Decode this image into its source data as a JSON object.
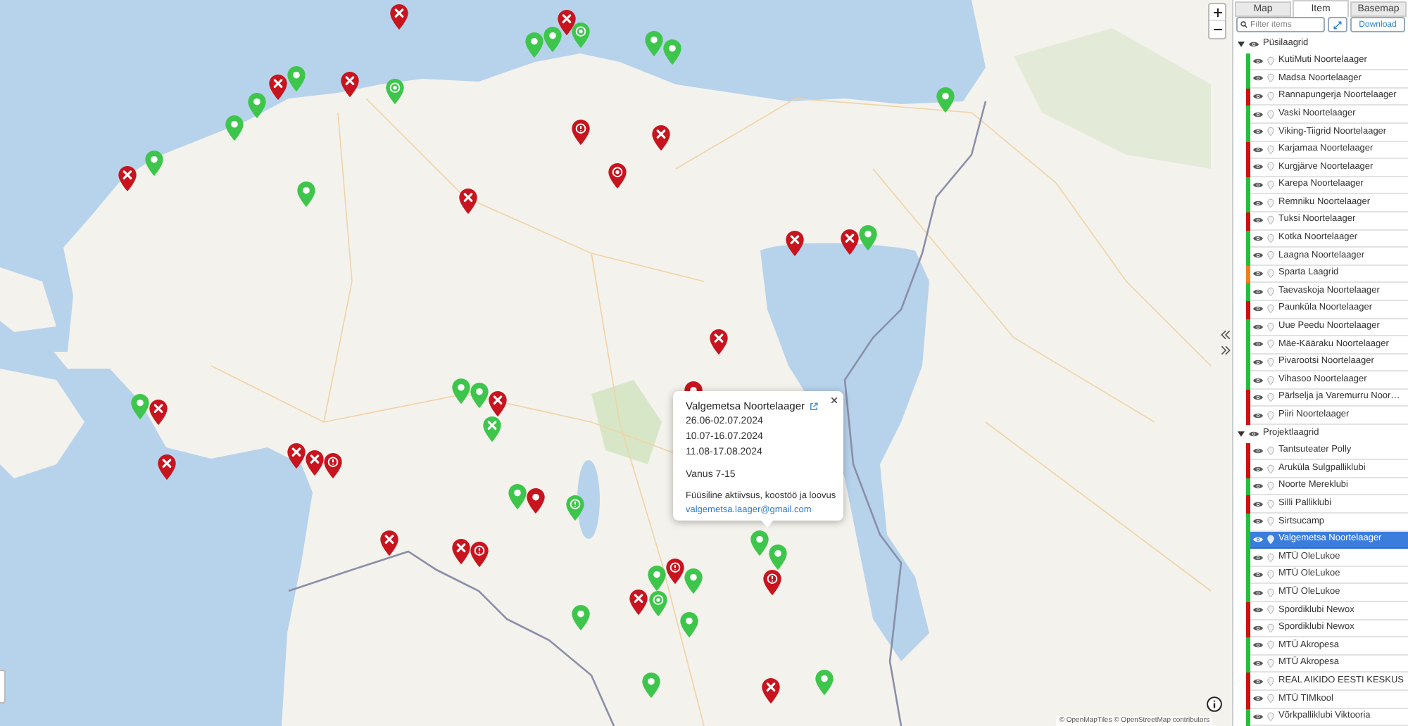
{
  "map": {
    "markers": [
      {
        "kind": "cross",
        "color": "#c8141e"
      },
      {
        "kind": "cross",
        "color": "#c8141e"
      },
      {
        "kind": "dot",
        "color": "#3ec64c"
      },
      {
        "kind": "dot",
        "color": "#3ec64c"
      },
      {
        "kind": "ring",
        "color": "#3ec64c"
      },
      {
        "kind": "dot",
        "color": "#3ec64c"
      },
      {
        "kind": "dot",
        "color": "#3ec64c"
      },
      {
        "kind": "cross",
        "color": "#c8141e"
      },
      {
        "kind": "dot",
        "color": "#3ec64c"
      },
      {
        "kind": "cross",
        "color": "#c8141e"
      },
      {
        "kind": "ring",
        "color": "#3ec64c"
      },
      {
        "kind": "dot",
        "color": "#3ec64c"
      },
      {
        "kind": "dot",
        "color": "#3ec64c"
      },
      {
        "kind": "dot",
        "color": "#3ec64c"
      },
      {
        "kind": "cross",
        "color": "#c8141e"
      },
      {
        "kind": "dot",
        "color": "#3ec64c"
      },
      {
        "kind": "cross",
        "color": "#c8141e"
      },
      {
        "kind": "info",
        "color": "#c8141e"
      },
      {
        "kind": "ring",
        "color": "#c8141e"
      },
      {
        "kind": "cross",
        "color": "#c8141e"
      },
      {
        "kind": "dot",
        "color": "#3ec64c"
      },
      {
        "kind": "cross",
        "color": "#c8141e"
      },
      {
        "kind": "dot",
        "color": "#3ec64c"
      },
      {
        "kind": "cross",
        "color": "#c8141e"
      },
      {
        "kind": "cross",
        "color": "#c8141e"
      },
      {
        "kind": "dot",
        "color": "#c8141e"
      },
      {
        "kind": "dot",
        "color": "#3ec64c"
      },
      {
        "kind": "cross",
        "color": "#c8141e"
      },
      {
        "kind": "cross",
        "color": "#c8141e"
      },
      {
        "kind": "cross",
        "color": "#c8141e"
      },
      {
        "kind": "cross",
        "color": "#c8141e"
      },
      {
        "kind": "info",
        "color": "#c8141e"
      },
      {
        "kind": "dot",
        "color": "#3ec64c"
      },
      {
        "kind": "dot",
        "color": "#3ec64c"
      },
      {
        "kind": "cross",
        "color": "#c8141e"
      },
      {
        "kind": "cross",
        "color": "#3ec64c"
      },
      {
        "kind": "dot",
        "color": "#c8141e"
      },
      {
        "kind": "dot",
        "color": "#3ec64c"
      },
      {
        "kind": "info",
        "color": "#3ec64c"
      },
      {
        "kind": "cross",
        "color": "#c8141e"
      },
      {
        "kind": "cross",
        "color": "#c8141e"
      },
      {
        "kind": "info",
        "color": "#c8141e"
      },
      {
        "kind": "dot",
        "color": "#3ec64c"
      },
      {
        "kind": "dot",
        "color": "#3ec64c"
      },
      {
        "kind": "dot",
        "color": "#3ec64c"
      },
      {
        "kind": "info",
        "color": "#c8141e"
      },
      {
        "kind": "info",
        "color": "#c8141e"
      },
      {
        "kind": "dot",
        "color": "#3ec64c"
      },
      {
        "kind": "dot",
        "color": "#3ec64c"
      },
      {
        "kind": "cross",
        "color": "#c8141e"
      },
      {
        "kind": "ring",
        "color": "#3ec64c"
      },
      {
        "kind": "dot",
        "color": "#3ec64c"
      },
      {
        "kind": "dot",
        "color": "#3ec64c"
      },
      {
        "kind": "cross",
        "color": "#c8141e"
      },
      {
        "kind": "dot",
        "color": "#3ec64c"
      }
    ],
    "attribution": "© OpenMapTiles © OpenStreetMap contributors"
  },
  "popup": {
    "title": "Valgemetsa Noortelaager",
    "dates": [
      "26.06-02.07.2024",
      "10.07-16.07.2024",
      "11.08-17.08.2024"
    ],
    "age": "Vanus 7-15",
    "description": "Füüsiline aktiivsus, koostöö ja loovus",
    "email": "valgemetsa.laager@gmail.com"
  },
  "panel": {
    "tabs": [
      {
        "label": "Map",
        "selected": false
      },
      {
        "label": "Item",
        "selected": true
      },
      {
        "label": "Basemap",
        "selected": false
      }
    ],
    "filter": {
      "placeholder": "Filter items"
    },
    "download_button": "Download",
    "groups": [
      {
        "label": "Püsilaagrid",
        "expanded": true,
        "children": [
          {
            "label": "KutiMuti Noortelaager",
            "color": "#22c03a",
            "selected": false
          },
          {
            "label": "Madsa Noortelaager",
            "color": "#22c03a",
            "selected": false
          },
          {
            "label": "Rannapungerja Noortelaager",
            "color": "#cc1111",
            "selected": false
          },
          {
            "label": "Vaski Noortelaager",
            "color": "#22c03a",
            "selected": false
          },
          {
            "label": "Viking-Tiigrid Noortelaager",
            "color": "#22c03a",
            "selected": false
          },
          {
            "label": "Karjamaa Noortelaager",
            "color": "#cc1111",
            "selected": false
          },
          {
            "label": "Kurgjärve Noortelaager",
            "color": "#cc1111",
            "selected": false
          },
          {
            "label": "Karepa Noortelaager",
            "color": "#22c03a",
            "selected": false
          },
          {
            "label": "Remniku Noortelaager",
            "color": "#22c03a",
            "selected": false
          },
          {
            "label": "Tuksi Noortelaager",
            "color": "#cc1111",
            "selected": false
          },
          {
            "label": "Kotka Noortelaager",
            "color": "#22c03a",
            "selected": false
          },
          {
            "label": "Laagna Noortelaager",
            "color": "#22c03a",
            "selected": false
          },
          {
            "label": "Sparta Laagrid",
            "color": "#f07f1a",
            "selected": false
          },
          {
            "label": "Taevaskoja Noortelaager",
            "color": "#22c03a",
            "selected": false
          },
          {
            "label": "Paunküla Noortelaager",
            "color": "#cc1111",
            "selected": false
          },
          {
            "label": "Uue Peedu Noortelaager",
            "color": "#22c03a",
            "selected": false
          },
          {
            "label": "Mäe-Kääraku Noortelaager",
            "color": "#22c03a",
            "selected": false
          },
          {
            "label": "Pivarootsi Noortelaager",
            "color": "#22c03a",
            "selected": false
          },
          {
            "label": "Vihasoo Noortelaager",
            "color": "#22c03a",
            "selected": false
          },
          {
            "label": "Pärlselja ja Varemurru Noor…",
            "color": "#cc1111",
            "selected": false
          },
          {
            "label": "Piiri Noortelaager",
            "color": "#cc1111",
            "selected": false
          }
        ]
      },
      {
        "label": "Projektlaagrid",
        "expanded": true,
        "children": [
          {
            "label": "Tantsuteater Polly",
            "color": "#cc1111",
            "selected": false
          },
          {
            "label": "Aruküla Sulgpalliklubi",
            "color": "#cc1111",
            "selected": false
          },
          {
            "label": "Noorte Mereklubi",
            "color": "#22c03a",
            "selected": false
          },
          {
            "label": "Silli Palliklubi",
            "color": "#cc1111",
            "selected": false
          },
          {
            "label": "Sirtsucamp",
            "color": "#22c03a",
            "selected": false
          },
          {
            "label": "Valgemetsa Noortelaager",
            "color": "#22c03a",
            "selected": true
          },
          {
            "label": "MTÜ OleLukoe",
            "color": "#22c03a",
            "selected": false
          },
          {
            "label": "MTÜ OleLukoe",
            "color": "#22c03a",
            "selected": false
          },
          {
            "label": "MTÜ OleLukoe",
            "color": "#22c03a",
            "selected": false
          },
          {
            "label": "Spordiklubi Newox",
            "color": "#cc1111",
            "selected": false
          },
          {
            "label": "Spordiklubi Newox",
            "color": "#cc1111",
            "selected": false
          },
          {
            "label": "MTÜ Akropesa",
            "color": "#22c03a",
            "selected": false
          },
          {
            "label": "MTÜ Akropesa",
            "color": "#22c03a",
            "selected": false
          },
          {
            "label": "REAL AIKIDO EESTI KESKUS",
            "color": "#cc1111",
            "selected": false
          },
          {
            "label": "MTÜ TIMkool",
            "color": "#cc1111",
            "selected": false
          },
          {
            "label": "Võrkpalliklubi Viktooria",
            "color": "#22c03a",
            "selected": false
          }
        ]
      }
    ]
  }
}
